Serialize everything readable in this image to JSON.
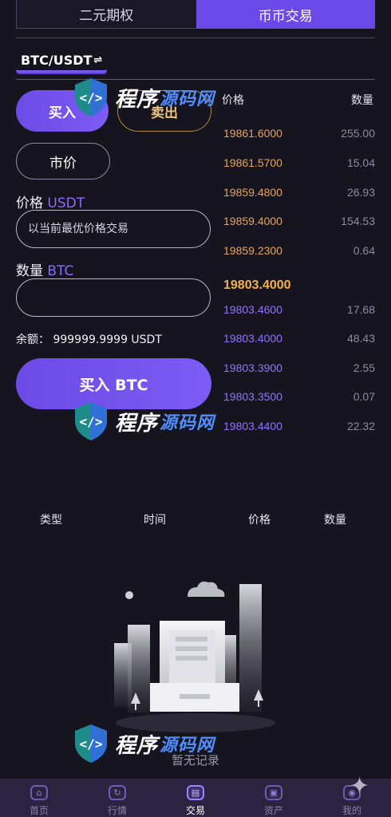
{
  "tabs": [
    "二元期权",
    "币币交易"
  ],
  "pair": "BTC/USDT",
  "pair_switch_icon": "swap-lines-icon",
  "order": {
    "buy_tab": "买入",
    "sell_tab": "卖出",
    "market_tab": "市价",
    "price_label": "价格",
    "price_unit": "USDT",
    "price_placeholder": "以当前最优价格交易",
    "qty_label": "数量",
    "qty_unit": "BTC",
    "qty_value": "",
    "balance": "余额：  999999.9999 USDT",
    "submit": "买入 BTC"
  },
  "orderbook": {
    "price_header": "价格",
    "qty_header": "数量",
    "asks": [
      {
        "price": "19861.6000",
        "qty": "255.00"
      },
      {
        "price": "19861.5700",
        "qty": "15.04"
      },
      {
        "price": "19859.4800",
        "qty": "26.93"
      },
      {
        "price": "19859.4000",
        "qty": "154.53"
      },
      {
        "price": "19859.2300",
        "qty": "0.64"
      }
    ],
    "last_price": "19803.4000",
    "bids": [
      {
        "price": "19803.4600",
        "qty": "17.68"
      },
      {
        "price": "19803.4000",
        "qty": "48.43"
      },
      {
        "price": "19803.3900",
        "qty": "2.55"
      },
      {
        "price": "19803.3500",
        "qty": "0.07"
      },
      {
        "price": "19803.4400",
        "qty": "22.32"
      }
    ]
  },
  "history": {
    "columns": [
      "类型",
      "时间",
      "价格",
      "数量"
    ],
    "empty_text": "暂无记录"
  },
  "nav": {
    "items": [
      {
        "label": "首页",
        "icon": "home-icon"
      },
      {
        "label": "行情",
        "icon": "market-icon"
      },
      {
        "label": "交易",
        "icon": "trade-icon"
      },
      {
        "label": "资产",
        "icon": "assets-icon"
      },
      {
        "label": "我的",
        "icon": "profile-icon"
      }
    ],
    "active_index": 2
  },
  "watermark": {
    "text_white": "程序",
    "text_blue": "源码网"
  },
  "colors": {
    "accent": "#6b49e8",
    "ask": "#e8a35a",
    "bid": "#8f74ff",
    "last": "#f2b34a",
    "background": "#16141f"
  }
}
